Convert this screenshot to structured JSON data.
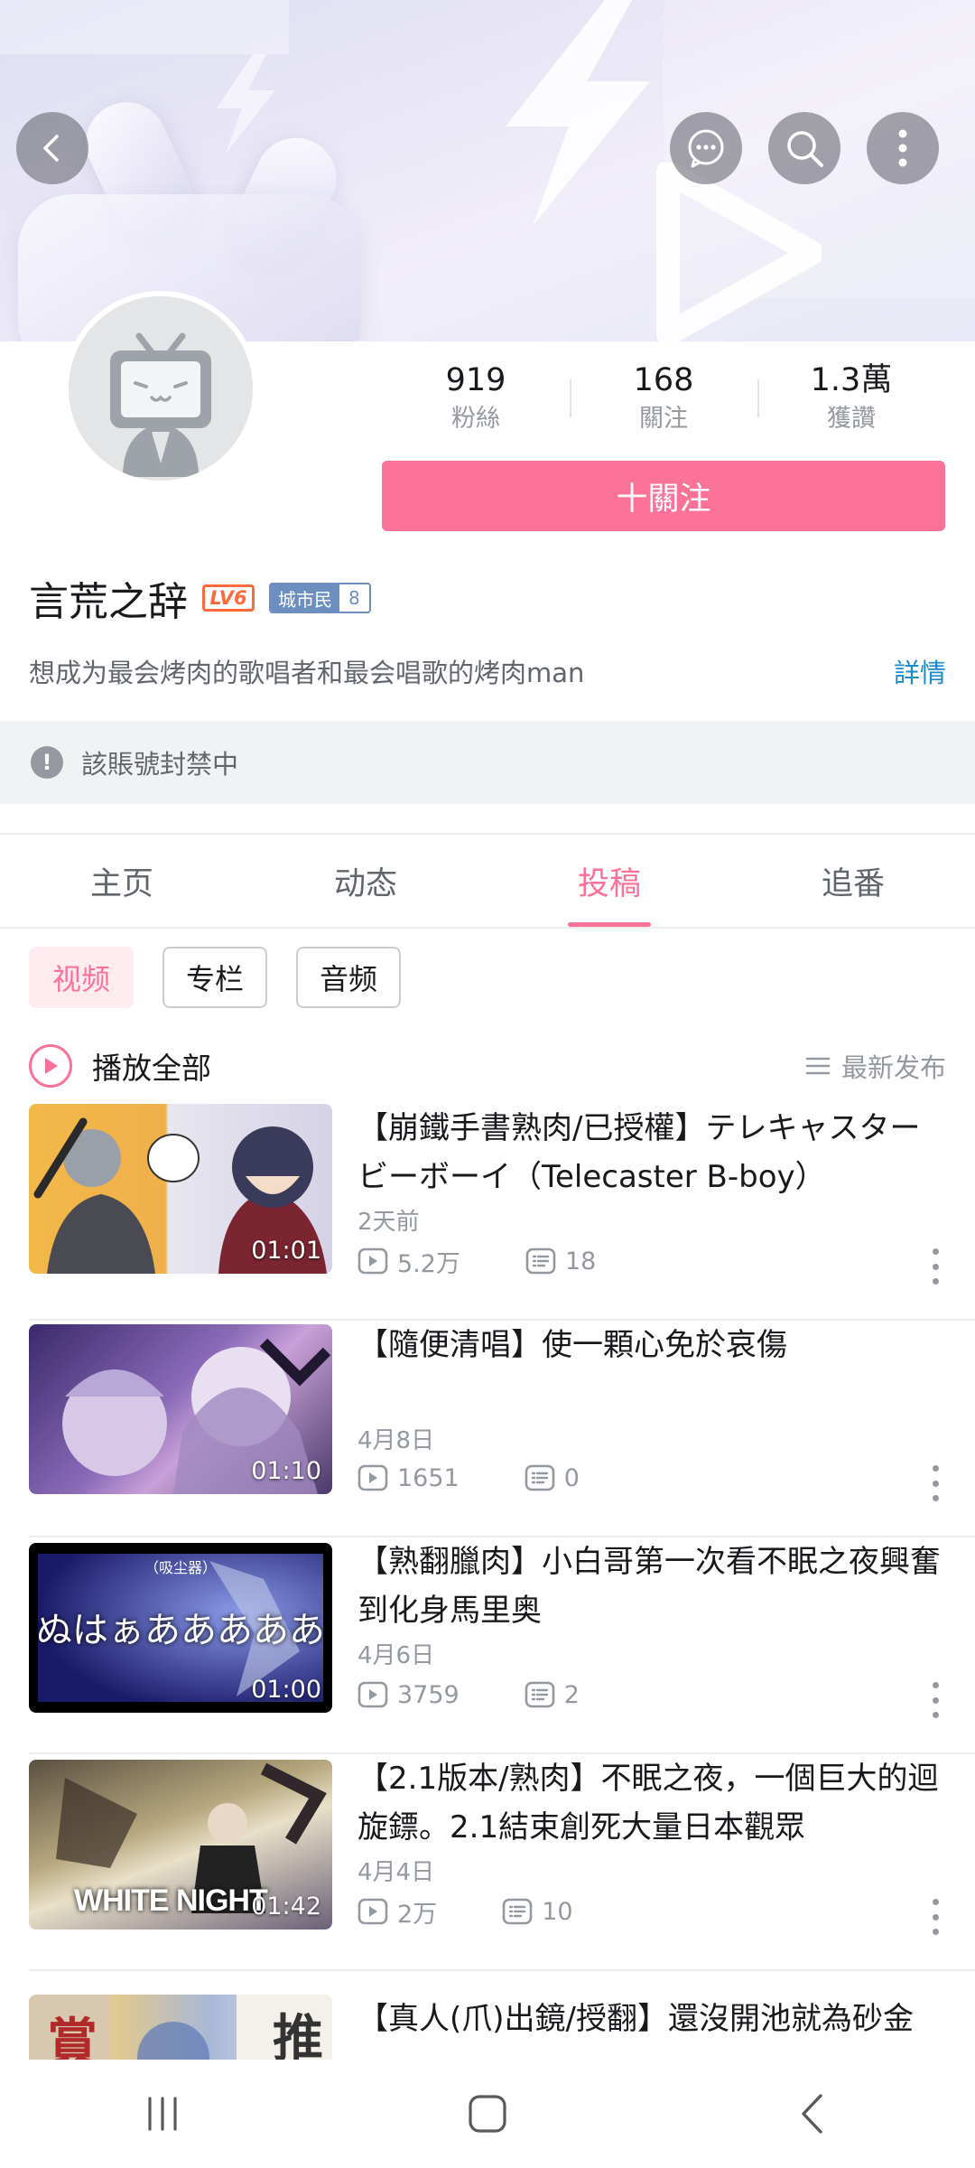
{
  "profile": {
    "name": "言荒之辞",
    "level_badge": "LV6",
    "medal_name": "城市民",
    "medal_level": "8",
    "signature": "想成为最会烤肉的歌唱者和最会唱歌的烤肉man",
    "detail_label": "詳情",
    "stats": [
      {
        "value": "919",
        "label": "粉絲"
      },
      {
        "value": "168",
        "label": "關注"
      },
      {
        "value": "1.3萬",
        "label": "獲讚"
      }
    ],
    "follow_label": "十關注"
  },
  "notice": {
    "text": "該賬號封禁中"
  },
  "tabs": [
    {
      "label": "主页",
      "active": false
    },
    {
      "label": "动态",
      "active": false
    },
    {
      "label": "投稿",
      "active": true
    },
    {
      "label": "追番",
      "active": false
    }
  ],
  "filters": [
    {
      "label": "视频",
      "active": true
    },
    {
      "label": "专栏",
      "active": false
    },
    {
      "label": "音频",
      "active": false
    }
  ],
  "list_header": {
    "play_all": "播放全部",
    "sort": "最新发布"
  },
  "videos": [
    {
      "title": "【崩鐵手書熟肉/已授權】テレキャスタービーボーイ（Telecaster B-boy）",
      "date": "2天前",
      "views": "5.2万",
      "comments": "18",
      "duration": "01:01"
    },
    {
      "title": "【隨便清唱】使一顆心免於哀傷",
      "date": "4月8日",
      "views": "1651",
      "comments": "0",
      "duration": "01:10"
    },
    {
      "title": "【熟翻臘肉】小白哥第一次看不眠之夜興奮到化身馬里奥",
      "date": "4月6日",
      "views": "3759",
      "comments": "2",
      "duration": "01:00",
      "thumb_caption_top": "（吸尘器）",
      "thumb_caption": "ぬはぁあああああ"
    },
    {
      "title": "【2.1版本/熟肉】不眠之夜，一個巨大的迴旋鏢。2.1結束創死大量日本觀眾",
      "date": "4月4日",
      "views": "2万",
      "comments": "10",
      "duration": "01:42",
      "thumb_caption": "WHITE NIGHT"
    },
    {
      "title": "【真人(爪)出鏡/授翻】還沒開池就為砂金",
      "thumb_caption_left": "賞",
      "thumb_caption_right": "推"
    }
  ],
  "colors": {
    "accent": "#fb7299",
    "link": "#178bcf",
    "level": "#ff6a3d"
  }
}
